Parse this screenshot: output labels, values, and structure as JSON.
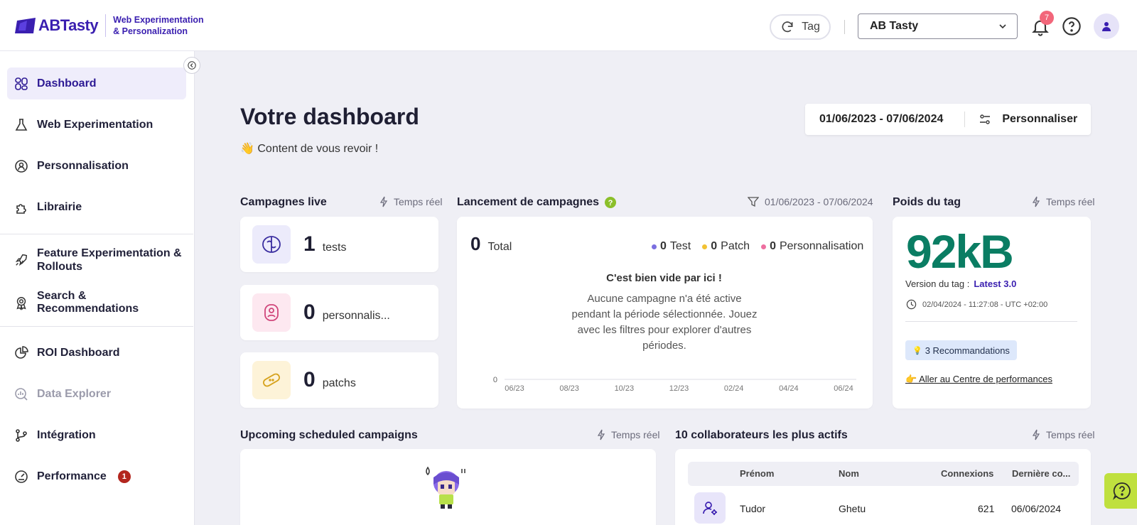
{
  "header": {
    "logo_text": "ABTasty",
    "logo_sub_line1": "Web Experimentation",
    "logo_sub_line2": "& Personalization",
    "tag_button": "Tag",
    "account": "AB Tasty",
    "notifications_count": "7"
  },
  "sidebar": {
    "items": [
      {
        "label": "Dashboard",
        "icon": "dashboard-icon",
        "active": true
      },
      {
        "label": "Web Experimentation",
        "icon": "flask-icon"
      },
      {
        "label": "Personnalisation",
        "icon": "user-target-icon"
      },
      {
        "label": "Librairie",
        "icon": "puzzle-icon"
      },
      {
        "label": "Feature Experimentation &",
        "label2": "Rollouts",
        "icon": "rocket-icon"
      },
      {
        "label": "Search & Recommendations",
        "icon": "award-icon"
      },
      {
        "label": "ROI Dashboard",
        "icon": "pie-chart-icon"
      },
      {
        "label": "Data Explorer",
        "icon": "search-chart-icon",
        "disabled": true
      },
      {
        "label": "Intégration",
        "icon": "git-branch-icon"
      },
      {
        "label": "Performance",
        "icon": "gauge-icon",
        "badge": "1"
      }
    ]
  },
  "main": {
    "title": "Votre dashboard",
    "welcome": "👋 Content de vous revoir !",
    "date_range": "01/06/2023 - 07/06/2024",
    "personalize": "Personnaliser",
    "live": {
      "title": "Campagnes live",
      "realtime": "Temps réel",
      "cards": [
        {
          "count": "1",
          "label": "tests"
        },
        {
          "count": "0",
          "label": "personnalis..."
        },
        {
          "count": "0",
          "label": "patchs"
        }
      ]
    },
    "launch": {
      "title": "Lancement de campagnes",
      "filter_range": "01/06/2023 - 07/06/2024",
      "total_count": "0",
      "total_label": "Total",
      "legend": [
        {
          "count": "0",
          "label": "Test",
          "color": "#7b6fe0"
        },
        {
          "count": "0",
          "label": "Patch",
          "color": "#f2c233"
        },
        {
          "count": "0",
          "label": "Personnalisation",
          "color": "#ee6fa0"
        }
      ],
      "empty_title": "C'est bien vide par ici !",
      "empty_text": "Aucune campagne n'a été active pendant la période sélectionnée. Jouez avec les filtres pour explorer d'autres périodes."
    },
    "tag_weight": {
      "title": "Poids du tag",
      "realtime": "Temps réel",
      "value": "92kB",
      "version_label": "Version du tag :",
      "version_value": "Latest 3.0",
      "date": "02/04/2024 - 11:27:08 - UTC +02:00",
      "recommendations": "3 Recommandations",
      "perf_link": "👉 Aller au Centre de performances"
    },
    "upcoming": {
      "title": "Upcoming scheduled campaigns",
      "realtime": "Temps réel"
    },
    "collaborators": {
      "title": "10 collaborateurs les plus actifs",
      "realtime": "Temps réel",
      "columns": [
        "Prénom",
        "Nom",
        "Connexions",
        "Dernière co..."
      ],
      "rows": [
        {
          "first": "Tudor",
          "last": "Ghetu",
          "connections": "621",
          "last_conn": "06/06/2024"
        }
      ]
    }
  },
  "chart_data": {
    "type": "bar",
    "categories": [
      "06/23",
      "08/23",
      "10/23",
      "12/23",
      "02/24",
      "04/24",
      "06/24"
    ],
    "series": [
      {
        "name": "Test",
        "values": [
          0,
          0,
          0,
          0,
          0,
          0,
          0
        ]
      },
      {
        "name": "Patch",
        "values": [
          0,
          0,
          0,
          0,
          0,
          0,
          0
        ]
      },
      {
        "name": "Personnalisation",
        "values": [
          0,
          0,
          0,
          0,
          0,
          0,
          0
        ]
      }
    ],
    "yticks": [
      "0"
    ]
  }
}
